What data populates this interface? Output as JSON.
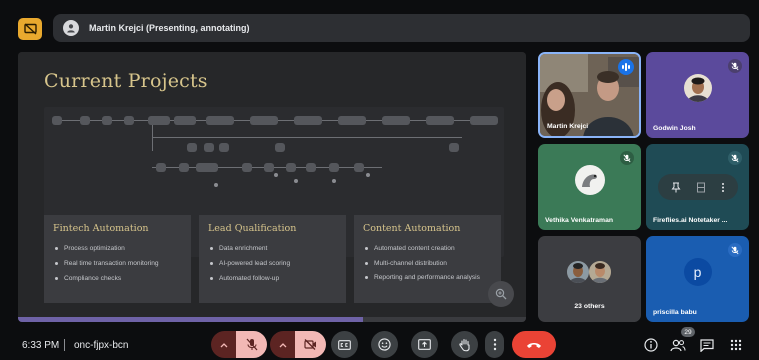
{
  "presenter": {
    "label": "Martin Krejci (Presenting, annotating)"
  },
  "slide": {
    "title": "Current Projects",
    "progress_fraction": 0.68,
    "cards": [
      {
        "title": "Fintech Automation",
        "items": [
          "Process optimization",
          "Real time transaction monitoring",
          "Compliance checks"
        ]
      },
      {
        "title": "Lead Qualification",
        "items": [
          "Data enrichment",
          "AI-powered lead scoring",
          "Automated follow-up"
        ]
      },
      {
        "title": "Content Automation",
        "items": [
          "Automated content creation",
          "Multi-channel distribution",
          "Reporting and performance analysis"
        ]
      }
    ]
  },
  "participants": [
    {
      "name": "Martin Krejci",
      "state": "speaking"
    },
    {
      "name": "Godwin Josh",
      "state": "muted"
    },
    {
      "name": "Vethika Venkatraman",
      "state": "muted"
    },
    {
      "name": "Fireflies.ai Notetaker ...",
      "state": "muted"
    },
    {
      "name": "23 others",
      "state": "group"
    },
    {
      "name": "priscilla babu",
      "initial": "p",
      "state": "muted"
    }
  ],
  "footer": {
    "time": "6:33 PM",
    "meeting_code": "onc-fjpx-bcn",
    "participant_count": "29"
  },
  "colors": {
    "accent_gold": "#d7c58c",
    "leave_red": "#ea4335",
    "muted_red": "#f2b8b5",
    "presenting_yellow": "#e9a92e",
    "speaking_blue": "#1a73e8"
  }
}
